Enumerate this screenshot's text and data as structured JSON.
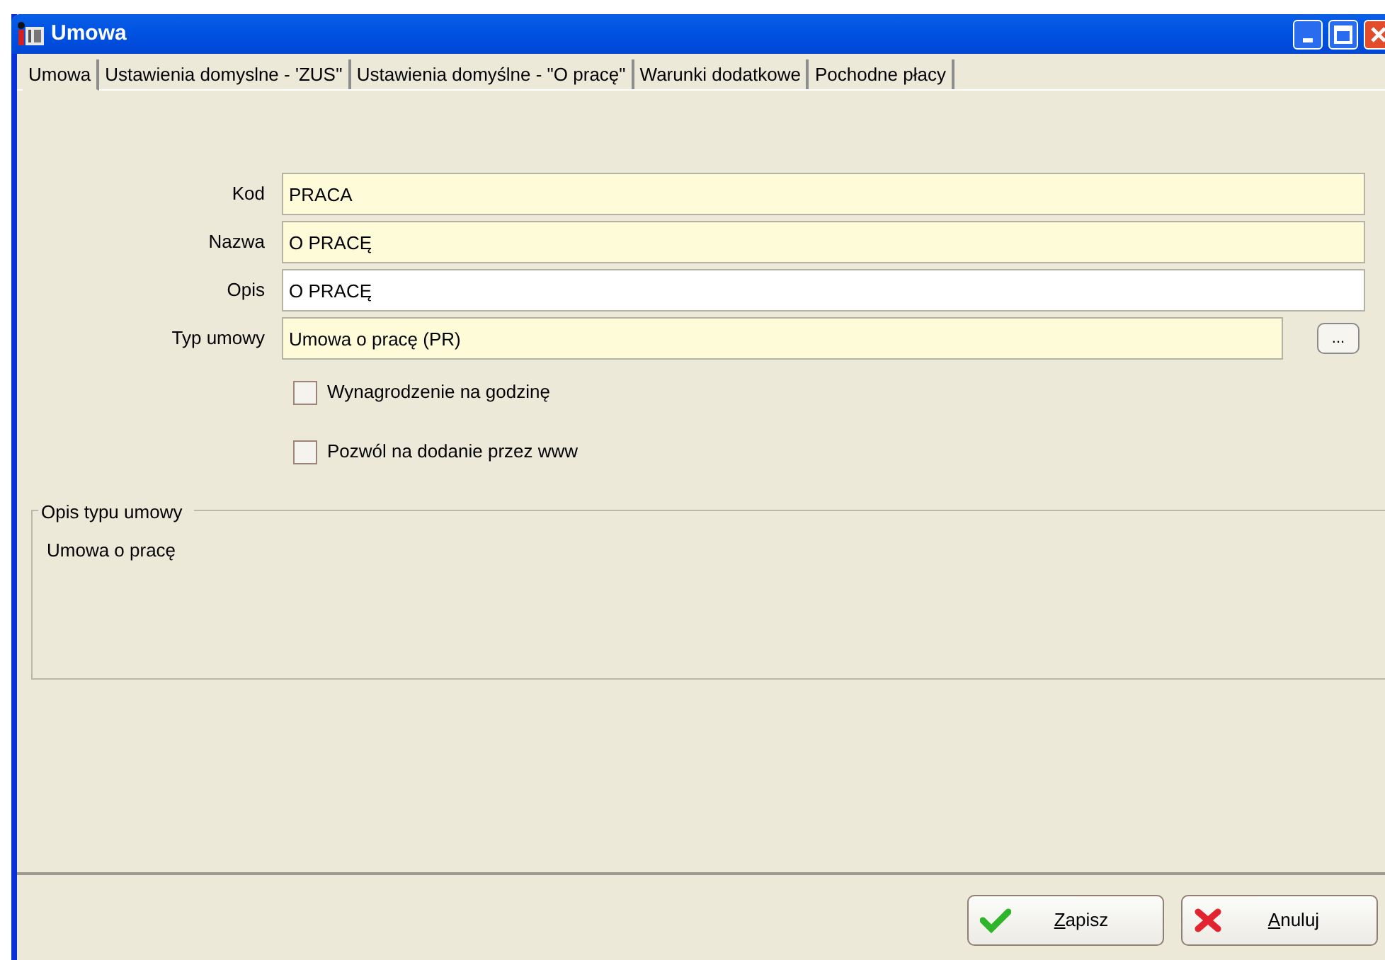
{
  "window": {
    "title": "Umowa"
  },
  "tabs": [
    {
      "label": "Umowa",
      "selected": true
    },
    {
      "label": "Ustawienia domyslne - 'ZUS''",
      "selected": false
    },
    {
      "label": "Ustawienia domyślne - \"O pracę\"",
      "selected": false
    },
    {
      "label": "Warunki dodatkowe",
      "selected": false
    },
    {
      "label": "Pochodne płacy",
      "selected": false
    }
  ],
  "fields": [
    {
      "label": "Kod",
      "value": "PRACA",
      "required": true
    },
    {
      "label": "Nazwa",
      "value": "O PRACĘ",
      "required": true
    },
    {
      "label": "Opis",
      "value": "O PRACĘ",
      "required": false
    },
    {
      "label": "Typ umowy",
      "value": "Umowa o pracę (PR)",
      "required": true,
      "browse": "..."
    }
  ],
  "checkboxes": [
    {
      "label": "Wynagrodzenie na godzinę",
      "checked": false
    },
    {
      "label": "Pozwól na dodanie przez www",
      "checked": false
    }
  ],
  "group": {
    "title": "Opis typu umowy",
    "text": "Umowa o pracę"
  },
  "buttons": [
    {
      "label": "Zapisz",
      "kind": "save"
    },
    {
      "label": "Anuluj",
      "kind": "cancel"
    }
  ]
}
